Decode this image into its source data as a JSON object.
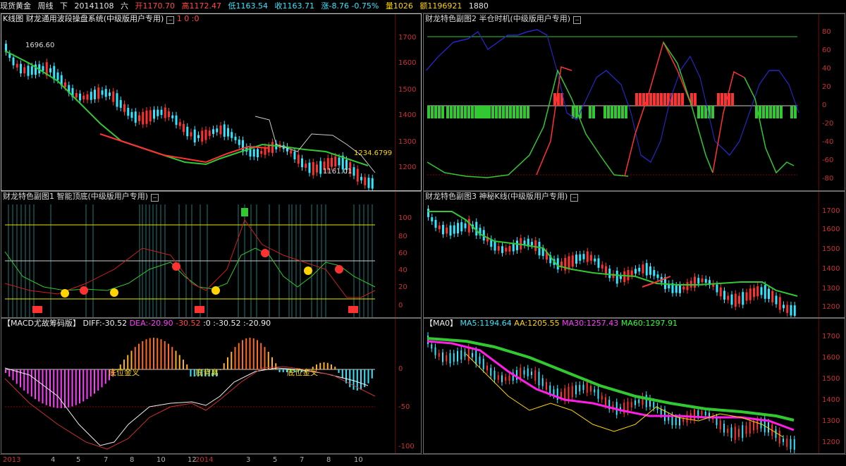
{
  "topbar": {
    "symbol": "现货黄金",
    "period": "周线",
    "mode": "下",
    "date": "20141108",
    "weekday": "六",
    "open": "开1170.70",
    "high": "高1172.47",
    "low": "低1163.54",
    "close": "收1163.71",
    "change": "涨-8.76 -0.75%",
    "volume": "量1026",
    "amount": "额1196921",
    "extra": "1880"
  },
  "panels": {
    "kline": {
      "title": "K线图",
      "indicator": "财龙通用波段操盘系统(中级版用户专用)",
      "params": "1   0 :0",
      "scale": [
        "1700",
        "1600",
        "1500",
        "1400",
        "1300",
        "1200"
      ],
      "label_high": "1696.60",
      "label_ma": "1234.6799",
      "label_low": "1161.01"
    },
    "sub2": {
      "title": "财龙特色副图2 半仓时机(中级版用户专用)",
      "scale": [
        "80",
        "60",
        "40",
        "20",
        "0",
        "-20",
        "-40",
        "-60",
        "-80"
      ]
    },
    "sub1": {
      "title": "财龙特色副图1 智能顶底(中级版用户专用)",
      "scale": [
        "100",
        "80",
        "60",
        "40",
        "20",
        "0"
      ]
    },
    "sub3": {
      "title": "财龙特色副图3 神秘K线(中级版用户专用)",
      "scale": [
        "1700",
        "1600",
        "1500",
        "1400",
        "1300",
        "1200"
      ]
    },
    "macd": {
      "title": "【MACD尤故筹码版】",
      "diff": "DIFF:-30.52",
      "dea": "DEA:-20.90",
      "v1": "-30.52",
      "v2": ":0",
      "v3": ":-30.52",
      "v4": ":-20.90",
      "scale": [
        "0",
        "-50",
        "-100"
      ],
      "labels": [
        "底位金叉",
        "底背离",
        "底位金叉"
      ]
    },
    "ma": {
      "title": "【MA0】",
      "ma5": "MA5:1194.64",
      "aa": "AA:1205.55",
      "ma30": "MA30:1257.43",
      "ma60": "MA60:1297.91",
      "scale": [
        "1700",
        "1600",
        "1500",
        "1400",
        "1300",
        "1200"
      ]
    }
  },
  "xaxis": [
    "2013",
    "4",
    "5",
    "7",
    "8",
    "10",
    "12",
    "2014",
    "3",
    "5",
    "7",
    "8",
    "10"
  ],
  "colors": {
    "up": "#ff3232",
    "down": "#32e6ff",
    "ma_green": "#32c832",
    "grid_red": "#8b0000",
    "macd_pos": "#ffa500",
    "macd_neg": "#ff3cff"
  }
}
